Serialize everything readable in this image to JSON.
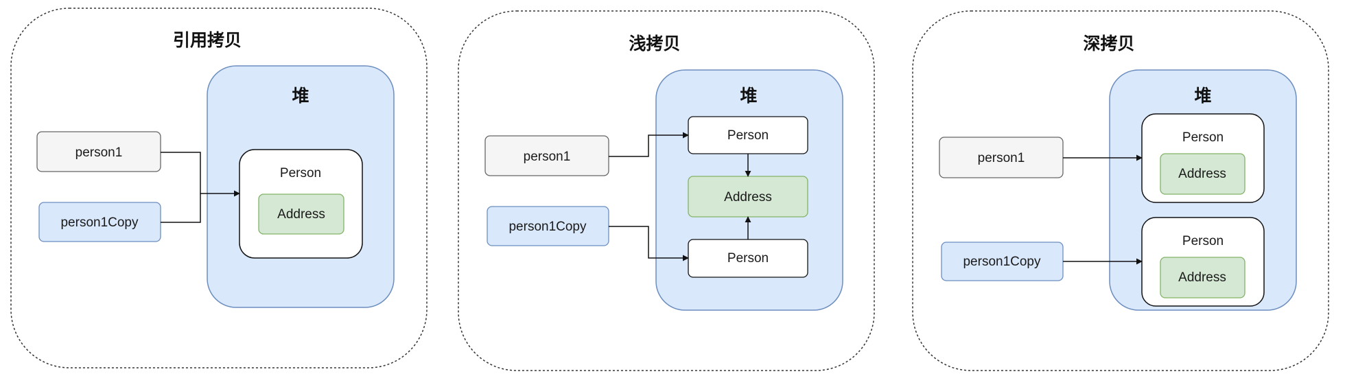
{
  "colors": {
    "panel_border": "#333333",
    "heap_fill": "#dae8fc",
    "heap_stroke": "#6c8ebf",
    "gray_fill": "#f5f5f5",
    "gray_stroke": "#666666",
    "blue_fill": "#dae8fc",
    "blue_stroke": "#6c8ebf",
    "green_fill": "#d5e8d4",
    "green_stroke": "#82b366",
    "white_fill": "#ffffff",
    "dark_stroke": "#111111",
    "arrow": "#111111"
  },
  "panels": [
    {
      "title": "引用拷贝",
      "heap_label": "堆",
      "var1": "person1",
      "var2": "person1Copy",
      "person": "Person",
      "address": "Address"
    },
    {
      "title": "浅拷贝",
      "heap_label": "堆",
      "var1": "person1",
      "var2": "person1Copy",
      "person_top": "Person",
      "address": "Address",
      "person_bottom": "Person"
    },
    {
      "title": "深拷贝",
      "heap_label": "堆",
      "var1": "person1",
      "var2": "person1Copy",
      "person_top": "Person",
      "address_top": "Address",
      "person_bottom": "Person",
      "address_bottom": "Address"
    }
  ]
}
